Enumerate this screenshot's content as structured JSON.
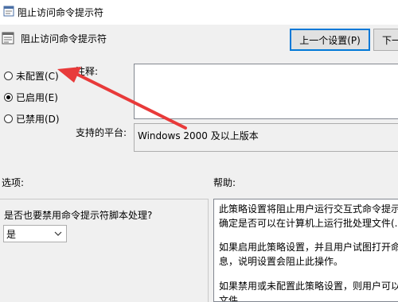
{
  "window": {
    "title": "阻止访问命令提示符",
    "app_icon": "policy-setting-icon"
  },
  "header": {
    "setting_title": "阻止访问命令提示符",
    "setting_icon": "policy-setting-icon",
    "prev_button": "上一个设置(P)",
    "next_button": "下一"
  },
  "state": {
    "options": [
      {
        "label": "未配置(C)",
        "selected": false
      },
      {
        "label": "已启用(E)",
        "selected": true
      },
      {
        "label": "已禁用(D)",
        "selected": false
      }
    ]
  },
  "comment": {
    "label": "注释:",
    "value": ""
  },
  "platform": {
    "label": "支持的平台:",
    "value": "Windows 2000 及以上版本"
  },
  "options_section": {
    "label": "选项:",
    "question": "是否也要禁用命令提示符脚本处理?",
    "dropdown_value": "是"
  },
  "help_section": {
    "label": "帮助:",
    "paragraphs": [
      {
        "line1": "此策略设置将阻止用户运行交互式命令提示符",
        "line2": "确定是否可以在计算机上运行批处理文件(.c"
      },
      {
        "line1": "如果启用此策略设置，并且用户试图打开命令",
        "line2": "息，说明设置会阻止此操作。"
      },
      {
        "line1": "如果禁用或未配置此策略设置，则用户可以正",
        "line2": "文件。"
      }
    ]
  },
  "annotation": {
    "arrow_color": "#e83a3a"
  }
}
